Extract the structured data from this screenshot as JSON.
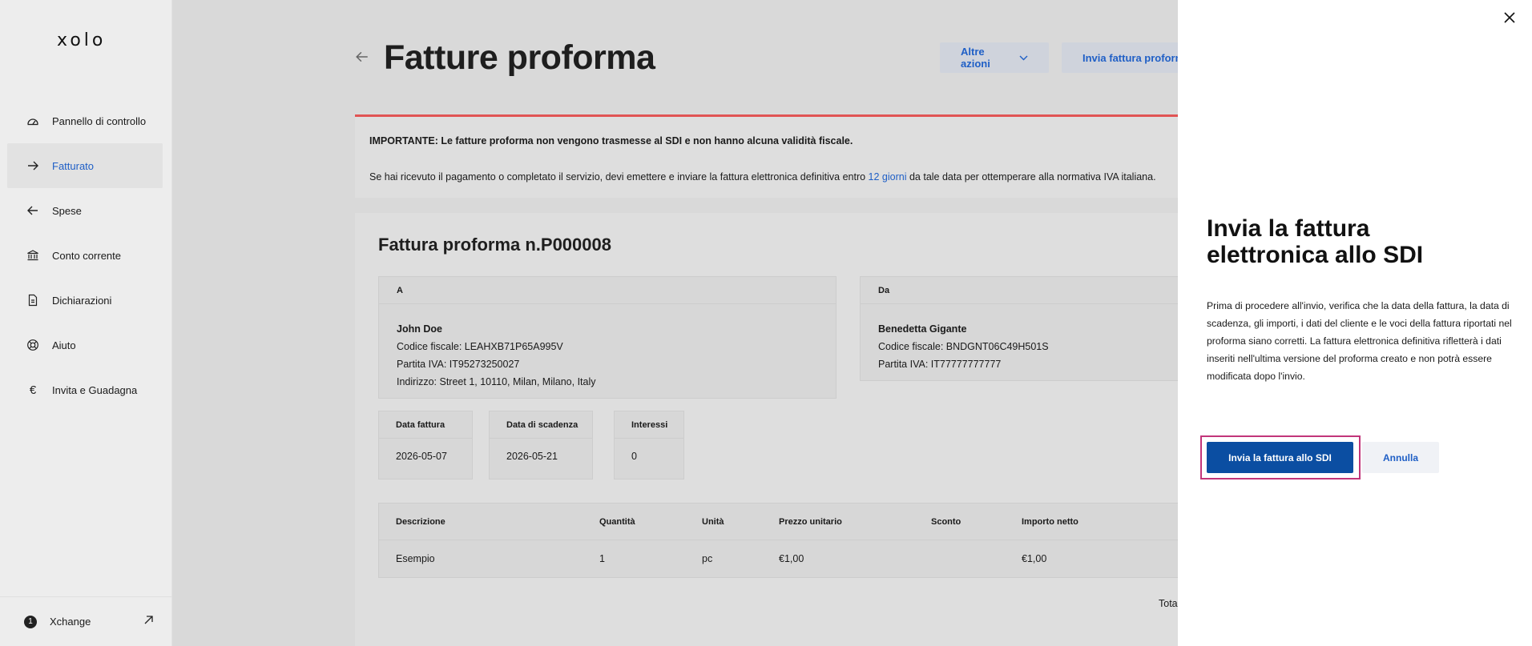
{
  "sidebar": {
    "logo": "xolo",
    "items": [
      {
        "label": "Pannello di controllo",
        "icon": "gauge-icon"
      },
      {
        "label": "Fatturato",
        "icon": "arrow-right-icon",
        "active": true
      },
      {
        "label": "Spese",
        "icon": "arrow-left-icon"
      },
      {
        "label": "Conto corrente",
        "icon": "bank-icon"
      },
      {
        "label": "Dichiarazioni",
        "icon": "document-icon"
      },
      {
        "label": "Aiuto",
        "icon": "lifebuoy-icon"
      },
      {
        "label": "Invita e Guadagna",
        "icon": "euro-icon"
      }
    ],
    "footer": {
      "badge": "1",
      "label": "Xchange"
    }
  },
  "page": {
    "title": "Fatture proforma",
    "more_actions": "Altre azioni",
    "send_button": "Invia fattura proform"
  },
  "alert": {
    "line1": "IMPORTANTE: Le fatture proforma non vengono trasmesse al SDI e non hanno alcuna validità fiscale.",
    "line2_before": "Se hai ricevuto il pagamento o completato il servizio, devi emettere e inviare la fattura elettronica definitiva entro ",
    "line2_link": "12 giorni",
    "line2_after": " da tale data per ottemperare alla normativa IVA italiana."
  },
  "invoice": {
    "title": "Fattura proforma n.P000008",
    "to": {
      "header": "A",
      "name": "John Doe",
      "tax_code": "Codice fiscale: LEAHXB71P65A995V",
      "vat": "Partita IVA: IT95273250027",
      "address": "Indirizzo: Street 1, 10110, Milan, Milano, Italy"
    },
    "from": {
      "header": "Da",
      "name": "Benedetta Gigante",
      "tax_code": "Codice fiscale: BNDGNT06C49H501S",
      "vat": "Partita IVA: IT77777777777"
    },
    "meta": {
      "date_label": "Data fattura",
      "date_value": "2026-05-07",
      "due_label": "Data di scadenza",
      "due_value": "2026-05-21",
      "interest_label": "Interessi",
      "interest_value": "0"
    },
    "table": {
      "headers": [
        "Descrizione",
        "Quantità",
        "Unità",
        "Prezzo unitario",
        "Sconto",
        "Importo netto"
      ],
      "rows": [
        [
          "Esempio",
          "1",
          "pc",
          "€1,00",
          "",
          "€1,00"
        ]
      ]
    },
    "total_label": "Tota"
  },
  "drawer": {
    "title": "Invia la fattura elettronica allo SDI",
    "text": "Prima di procedere all'invio, verifica che la data della fattura, la data di scadenza, gli importi, i dati del cliente e le voci della fattura riportati nel proforma siano corretti. La fattura elettronica definitiva rifletterà i dati inseriti nell'ultima versione del proforma creato e non potrà essere modificata dopo l'invio.",
    "primary": "Invia la fattura allo SDI",
    "cancel": "Annulla"
  }
}
